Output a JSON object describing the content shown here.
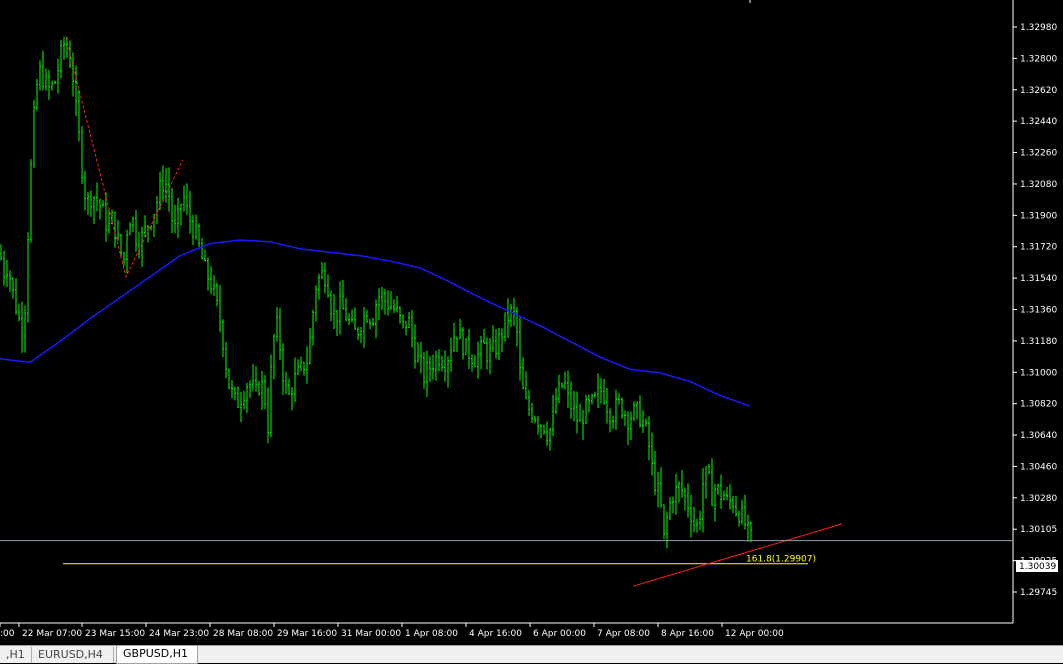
{
  "window": {
    "symbol": "GBPUSD",
    "timeframe": "H1"
  },
  "tabs": [
    {
      "label": ",H1",
      "active": false
    },
    {
      "label": "EURUSD,H4",
      "active": false
    },
    {
      "label": "GBPUSD,H1",
      "active": true
    }
  ],
  "colors": {
    "background": "#000000",
    "candles": "#00ff00",
    "moving_average": "#0000ff",
    "fib_line": "#ffff00",
    "trend_line": "#ff0000",
    "bid_line": "#708090",
    "axis_text": "#ffffff",
    "zigzag": "#ff0000"
  },
  "chart_data": {
    "type": "ohlc",
    "ylim": [
      1.2974,
      1.3305
    ],
    "price_ticks": [
      "1.32980",
      "1.32800",
      "1.32620",
      "1.32440",
      "1.32260",
      "1.32080",
      "1.31900",
      "1.31720",
      "1.31540",
      "1.31360",
      "1.31180",
      "1.31000",
      "1.30820",
      "1.30640",
      "1.30460",
      "1.30280",
      "1.30105",
      "1.29925",
      "1.29745"
    ],
    "time_ticks": [
      ":00",
      "22 Mar 07:00",
      "23 Mar 15:00",
      "24 Mar 23:00",
      "28 Mar 08:00",
      "29 Mar 16:00",
      "31 Mar 00:00",
      "1 Apr 08:00",
      "4 Apr 16:00",
      "6 Apr 00:00",
      "7 Apr 08:00",
      "8 Apr 16:00",
      "12 Apr 00:00"
    ],
    "current_price": "1.30039",
    "fib_label": "161.8(1.29907)",
    "fib_level": 1.29907,
    "price_path": [
      [
        0,
        1.3168
      ],
      [
        4,
        1.3158
      ],
      [
        8,
        1.3162
      ],
      [
        12,
        1.3148
      ],
      [
        16,
        1.3138
      ],
      [
        20,
        1.3128
      ],
      [
        24,
        1.3125
      ],
      [
        28,
        1.318
      ],
      [
        32,
        1.323
      ],
      [
        36,
        1.3262
      ],
      [
        40,
        1.3272
      ],
      [
        44,
        1.3268
      ],
      [
        48,
        1.3262
      ],
      [
        52,
        1.3264
      ],
      [
        56,
        1.3268
      ],
      [
        60,
        1.328
      ],
      [
        64,
        1.3288
      ],
      [
        68,
        1.3282
      ],
      [
        72,
        1.3276
      ],
      [
        76,
        1.325
      ],
      [
        80,
        1.323
      ],
      [
        84,
        1.3205
      ],
      [
        88,
        1.3198
      ],
      [
        92,
        1.3202
      ],
      [
        96,
        1.32
      ],
      [
        100,
        1.3196
      ],
      [
        104,
        1.319
      ],
      [
        108,
        1.3182
      ],
      [
        112,
        1.3188
      ],
      [
        116,
        1.318
      ],
      [
        120,
        1.317
      ],
      [
        124,
        1.3165
      ],
      [
        128,
        1.3188
      ],
      [
        132,
        1.319
      ],
      [
        136,
        1.3178
      ],
      [
        140,
        1.3175
      ],
      [
        144,
        1.318
      ],
      [
        148,
        1.3185
      ],
      [
        152,
        1.319
      ],
      [
        156,
        1.3196
      ],
      [
        160,
        1.3205
      ],
      [
        164,
        1.321
      ],
      [
        168,
        1.3206
      ],
      [
        172,
        1.3188
      ],
      [
        176,
        1.318
      ],
      [
        180,
        1.3196
      ],
      [
        184,
        1.32
      ],
      [
        188,
        1.319
      ],
      [
        192,
        1.3185
      ],
      [
        196,
        1.3178
      ],
      [
        200,
        1.317
      ],
      [
        204,
        1.316
      ],
      [
        208,
        1.3155
      ],
      [
        212,
        1.315
      ],
      [
        216,
        1.314
      ],
      [
        220,
        1.313
      ],
      [
        224,
        1.3115
      ],
      [
        228,
        1.3095
      ],
      [
        232,
        1.3088
      ],
      [
        236,
        1.3082
      ],
      [
        240,
        1.3085
      ],
      [
        244,
        1.309
      ],
      [
        248,
        1.3095
      ],
      [
        252,
        1.3092
      ],
      [
        256,
        1.3088
      ],
      [
        260,
        1.3095
      ],
      [
        264,
        1.309
      ],
      [
        268,
        1.307
      ],
      [
        272,
        1.311
      ],
      [
        276,
        1.313
      ],
      [
        280,
        1.3115
      ],
      [
        284,
        1.3095
      ],
      [
        288,
        1.3085
      ],
      [
        292,
        1.3092
      ],
      [
        296,
        1.3098
      ],
      [
        300,
        1.31
      ],
      [
        304,
        1.3105
      ],
      [
        308,
        1.3108
      ],
      [
        312,
        1.313
      ],
      [
        316,
        1.315
      ],
      [
        320,
        1.3155
      ],
      [
        324,
        1.3158
      ],
      [
        328,
        1.315
      ],
      [
        332,
        1.3135
      ],
      [
        336,
        1.3132
      ],
      [
        340,
        1.3138
      ],
      [
        344,
        1.3135
      ],
      [
        348,
        1.313
      ],
      [
        352,
        1.3125
      ],
      [
        356,
        1.3122
      ],
      [
        360,
        1.3128
      ],
      [
        364,
        1.3132
      ],
      [
        368,
        1.3135
      ],
      [
        372,
        1.313
      ],
      [
        376,
        1.314
      ],
      [
        380,
        1.3145
      ],
      [
        384,
        1.3142
      ],
      [
        388,
        1.314
      ],
      [
        392,
        1.3138
      ],
      [
        396,
        1.3135
      ],
      [
        400,
        1.313
      ],
      [
        404,
        1.3125
      ],
      [
        408,
        1.3132
      ],
      [
        412,
        1.312
      ],
      [
        416,
        1.311
      ],
      [
        420,
        1.3105
      ],
      [
        424,
        1.3098
      ],
      [
        428,
        1.3102
      ],
      [
        432,
        1.3105
      ],
      [
        436,
        1.3108
      ],
      [
        440,
        1.311
      ],
      [
        444,
        1.3106
      ],
      [
        448,
        1.311
      ],
      [
        452,
        1.3118
      ],
      [
        456,
        1.3125
      ],
      [
        460,
        1.312
      ],
      [
        464,
        1.3115
      ],
      [
        468,
        1.3112
      ],
      [
        472,
        1.311
      ],
      [
        476,
        1.3108
      ],
      [
        480,
        1.3112
      ],
      [
        484,
        1.3115
      ],
      [
        488,
        1.311
      ],
      [
        492,
        1.3112
      ],
      [
        496,
        1.3115
      ],
      [
        500,
        1.312
      ],
      [
        504,
        1.3128
      ],
      [
        508,
        1.3132
      ],
      [
        512,
        1.3135
      ],
      [
        516,
        1.313
      ],
      [
        520,
        1.31
      ],
      [
        524,
        1.3085
      ],
      [
        528,
        1.308
      ],
      [
        532,
        1.3078
      ],
      [
        536,
        1.3075
      ],
      [
        540,
        1.3072
      ],
      [
        544,
        1.307
      ],
      [
        548,
        1.3065
      ],
      [
        552,
        1.307
      ],
      [
        556,
        1.3085
      ],
      [
        560,
        1.309
      ],
      [
        564,
        1.3095
      ],
      [
        568,
        1.3085
      ],
      [
        572,
        1.308
      ],
      [
        576,
        1.3075
      ],
      [
        580,
        1.307
      ],
      [
        584,
        1.3078
      ],
      [
        588,
        1.308
      ],
      [
        592,
        1.3082
      ],
      [
        596,
        1.3085
      ],
      [
        600,
        1.309
      ],
      [
        604,
        1.3088
      ],
      [
        608,
        1.308
      ],
      [
        612,
        1.3076
      ],
      [
        616,
        1.308
      ],
      [
        620,
        1.3082
      ],
      [
        624,
        1.3078
      ],
      [
        628,
        1.3074
      ],
      [
        632,
        1.3076
      ],
      [
        636,
        1.3078
      ],
      [
        640,
        1.3075
      ],
      [
        644,
        1.307
      ],
      [
        648,
        1.3062
      ],
      [
        652,
        1.3045
      ],
      [
        656,
        1.3035
      ],
      [
        660,
        1.3028
      ],
      [
        664,
        1.3005
      ],
      [
        668,
        1.302
      ],
      [
        672,
        1.303
      ],
      [
        676,
        1.3032
      ],
      [
        680,
        1.3035
      ],
      [
        684,
        1.303
      ],
      [
        688,
        1.3025
      ],
      [
        692,
        1.3018
      ],
      [
        696,
        1.301
      ],
      [
        700,
        1.302
      ],
      [
        704,
        1.3042
      ],
      [
        708,
        1.304
      ],
      [
        712,
        1.303
      ],
      [
        716,
        1.3035
      ],
      [
        720,
        1.303
      ],
      [
        724,
        1.303
      ],
      [
        728,
        1.3025
      ],
      [
        732,
        1.3028
      ],
      [
        736,
        1.3022
      ],
      [
        740,
        1.302
      ],
      [
        744,
        1.3015
      ],
      [
        748,
        1.3008
      ],
      [
        752,
        1.3004
      ]
    ],
    "moving_average_path": [
      [
        0,
        1.3108
      ],
      [
        30,
        1.3106
      ],
      [
        60,
        1.3118
      ],
      [
        90,
        1.3131
      ],
      [
        120,
        1.3143
      ],
      [
        150,
        1.3155
      ],
      [
        180,
        1.3167
      ],
      [
        210,
        1.3174
      ],
      [
        240,
        1.3176
      ],
      [
        270,
        1.3175
      ],
      [
        300,
        1.3171
      ],
      [
        330,
        1.3169
      ],
      [
        360,
        1.3167
      ],
      [
        390,
        1.3164
      ],
      [
        420,
        1.316
      ],
      [
        450,
        1.3152
      ],
      [
        480,
        1.3143
      ],
      [
        510,
        1.3135
      ],
      [
        540,
        1.3127
      ],
      [
        570,
        1.3118
      ],
      [
        600,
        1.3109
      ],
      [
        630,
        1.3102
      ],
      [
        660,
        1.31
      ],
      [
        690,
        1.3095
      ],
      [
        720,
        1.3087
      ],
      [
        750,
        1.3081
      ]
    ],
    "zigzag_path": [
      [
        66,
        1.3292
      ],
      [
        126,
        1.3155
      ],
      [
        183,
        1.3222
      ]
    ],
    "trend_line": [
      [
        633,
        1.29778
      ],
      [
        842,
        1.30135
      ]
    ]
  }
}
